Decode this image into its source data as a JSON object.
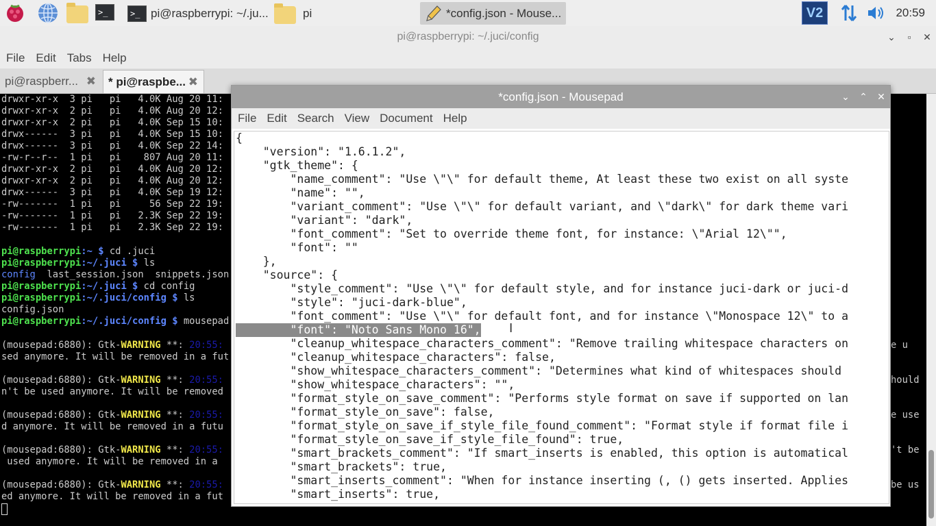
{
  "taskbar": {
    "tasks": [
      {
        "label": "pi@raspberrypi: ~/.ju..."
      },
      {
        "label": "pi"
      },
      {
        "label": "*config.json - Mouse..."
      }
    ],
    "clock": "20:59"
  },
  "terminal": {
    "title": "pi@raspberrypi: ~/.juci/config",
    "menu": [
      "File",
      "Edit",
      "Tabs",
      "Help"
    ],
    "tabs": [
      {
        "label": "pi@raspberr..."
      },
      {
        "label": "* pi@raspbe..."
      }
    ],
    "listing": [
      "drwxr-xr-x  3 pi   pi   4.0K Aug 20 11:",
      "drwxr-xr-x  2 pi   pi   4.0K Aug 20 12:",
      "drwxr-xr-x  2 pi   pi   4.0K Sep 15 10:",
      "drwx------  3 pi   pi   4.0K Sep 15 10:",
      "drwx------  3 pi   pi   4.0K Sep 22 14:",
      "-rw-r--r--  1 pi   pi    807 Aug 20 11:",
      "drwxr-xr-x  2 pi   pi   4.0K Aug 20 12:",
      "drwxr-xr-x  2 pi   pi   4.0K Aug 20 12:",
      "drwx------  3 pi   pi   4.0K Sep 19 12:",
      "-rw-------  1 pi   pi     56 Sep 22 19:",
      "-rw-------  1 pi   pi   2.3K Sep 22 19:",
      "-rw-------  1 pi   pi   2.3K Sep 22 19:"
    ],
    "prompt_user": "pi@raspberrypi",
    "cmd1_dir": ":~ $ ",
    "cmd1": "cd .juci",
    "cmd2_dir": ":~/.juci $ ",
    "cmd2": "ls",
    "ls_out_1": "config",
    "ls_out_2": "  last_session.json  snippets.json",
    "cmd3_dir": ":~/.juci $ ",
    "cmd3": "cd config",
    "cmd4_dir": ":~/.juci/config $ ",
    "cmd4": "ls",
    "ls_out_3": "config.json",
    "cmd5_dir": ":~/.juci/config $ ",
    "cmd5": "mousepad",
    "warn_prefix": "(mousepad:6880): Gtk-",
    "warn_word": "WARNING",
    "warn_stars": " **: ",
    "warn_ts": "20:55:",
    "warn_tails": [
      "sed anymore. It will be removed in a fut",
      "n't be used anymore. It will be removed",
      "d anymore. It will be removed in a futu",
      " used anymore. It will be removed in a ",
      "ed anymore. It will be removed in a fut"
    ],
    "right_tails": [
      "e u",
      "hould",
      "e use",
      "'t be",
      "be us"
    ]
  },
  "mousepad": {
    "title": "*config.json - Mousepad",
    "menu": [
      "File",
      "Edit",
      "Search",
      "View",
      "Document",
      "Help"
    ],
    "lines": [
      "{",
      "    \"version\": \"1.6.1.2\",",
      "    \"gtk_theme\": {",
      "        \"name_comment\": \"Use \\\"\\\" for default theme, At least these two exist on all syste",
      "        \"name\": \"\",",
      "        \"variant_comment\": \"Use \\\"\\\" for default variant, and \\\"dark\\\" for dark theme vari",
      "        \"variant\": \"dark\",",
      "        \"font_comment\": \"Set to override theme font, for instance: \\\"Arial 12\\\"\",",
      "        \"font\": \"\"",
      "    },",
      "    \"source\": {",
      "        \"style_comment\": \"Use \\\"\\\" for default style, and for instance juci-dark or juci-d",
      "        \"style\": \"juci-dark-blue\",",
      "        \"font_comment\": \"Use \\\"\\\" for default font, and for instance \\\"Monospace 12\\\" to a",
      "        \"font\": \"Noto Sans Mono 16\",",
      "        \"cleanup_whitespace_characters_comment\": \"Remove trailing whitespace characters on",
      "        \"cleanup_whitespace_characters\": false,",
      "        \"show_whitespace_characters_comment\": \"Determines what kind of whitespaces should",
      "        \"show_whitespace_characters\": \"\",",
      "        \"format_style_on_save_comment\": \"Performs style format on save if supported on lan",
      "        \"format_style_on_save\": false,",
      "        \"format_style_on_save_if_style_file_found_comment\": \"Format style if format file i",
      "        \"format_style_on_save_if_style_file_found\": true,",
      "        \"smart_brackets_comment\": \"If smart_inserts is enabled, this option is automatical",
      "        \"smart_brackets\": true,",
      "        \"smart_inserts_comment\": \"When for instance inserting (, () gets inserted. Applies",
      "        \"smart_inserts\": true,"
    ]
  }
}
